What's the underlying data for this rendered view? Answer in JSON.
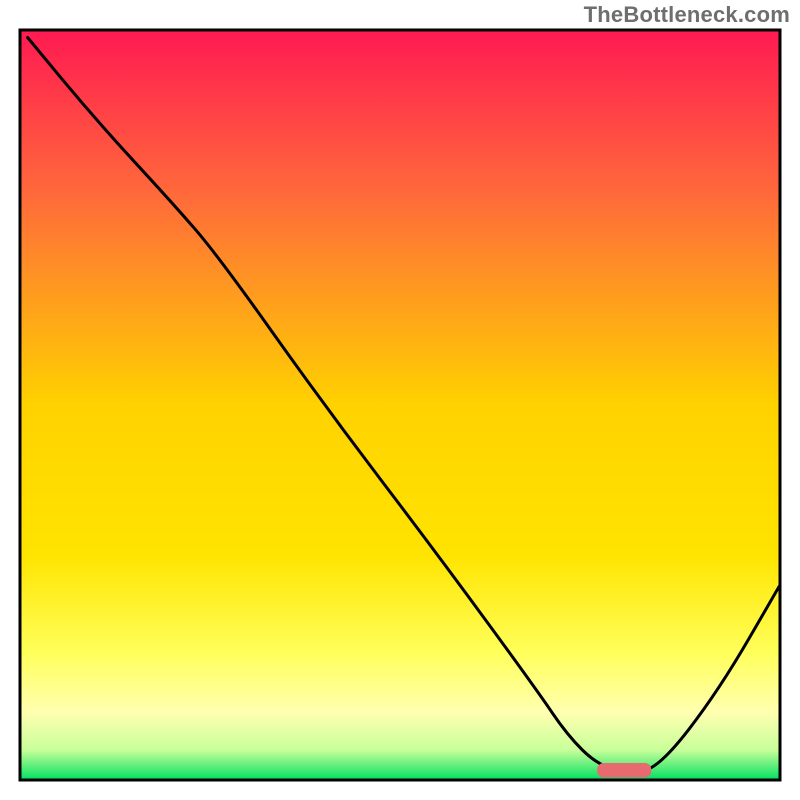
{
  "watermark": "TheBottleneck.com",
  "colors": {
    "gradient_top": "#ff1a52",
    "gradient_mid_upper": "#ff7a2a",
    "gradient_mid": "#ffd200",
    "gradient_mid_lower": "#ffff66",
    "gradient_pale_band": "#ffffb0",
    "gradient_bottom": "#00e060",
    "frame": "#000000",
    "curve": "#000000",
    "marker_fill": "#e66a6f",
    "marker_stroke": "#e66a6f"
  },
  "chart_data": {
    "type": "line",
    "title": "",
    "xlabel": "",
    "ylabel": "",
    "xlim": [
      0,
      100
    ],
    "ylim": [
      0,
      100
    ],
    "grid": false,
    "series": [
      {
        "name": "bottleneck-curve",
        "x": [
          1,
          10,
          20,
          26,
          40,
          55,
          68,
          72,
          76,
          80,
          84,
          92,
          100
        ],
        "values": [
          99,
          88,
          77,
          70,
          50,
          30,
          12,
          6,
          2,
          1,
          1.5,
          12,
          26
        ]
      }
    ],
    "marker": {
      "name": "optimal-range-bar",
      "x_start": 76,
      "x_end": 83,
      "y": 1.3,
      "height": 1.8
    },
    "annotations": []
  }
}
